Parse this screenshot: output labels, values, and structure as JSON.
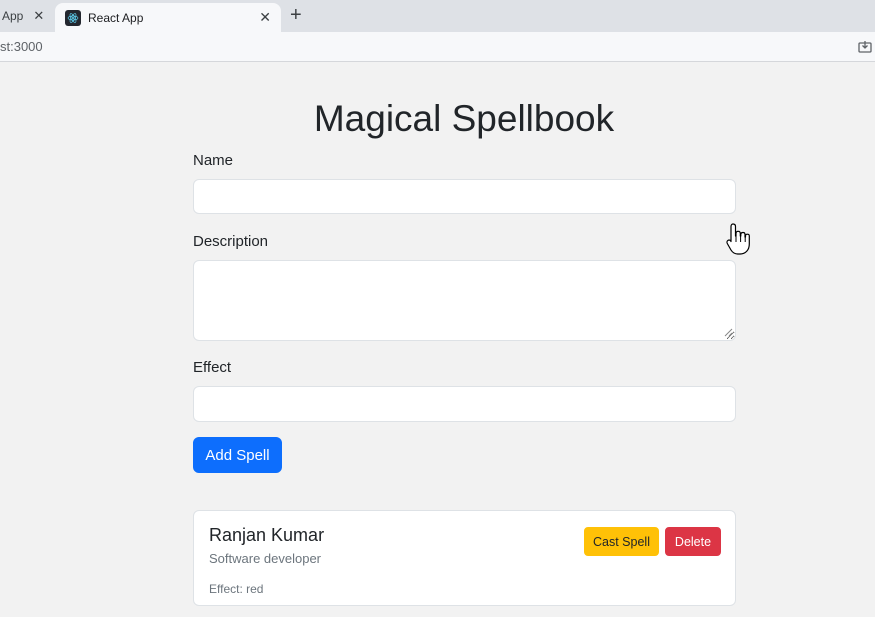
{
  "browser": {
    "prev_tab_title": "App",
    "active_tab_title": "React App",
    "url": "st:3000",
    "icons": [
      "close-icon",
      "react-favicon",
      "plus-icon",
      "install-icon"
    ]
  },
  "page": {
    "title": "Magical Spellbook",
    "form": {
      "name_label": "Name",
      "name_value": "",
      "description_label": "Description",
      "description_value": "",
      "effect_label": "Effect",
      "effect_value": "",
      "submit_label": "Add Spell"
    },
    "spells": [
      {
        "name": "Ranjan Kumar",
        "description": "Software developer",
        "effect": "Effect: red",
        "cast_label": "Cast Spell",
        "delete_label": "Delete"
      }
    ]
  },
  "colors": {
    "primary": "#0d6efd",
    "warning": "#ffc107",
    "danger": "#dc3545",
    "background": "#f2f2f2"
  }
}
